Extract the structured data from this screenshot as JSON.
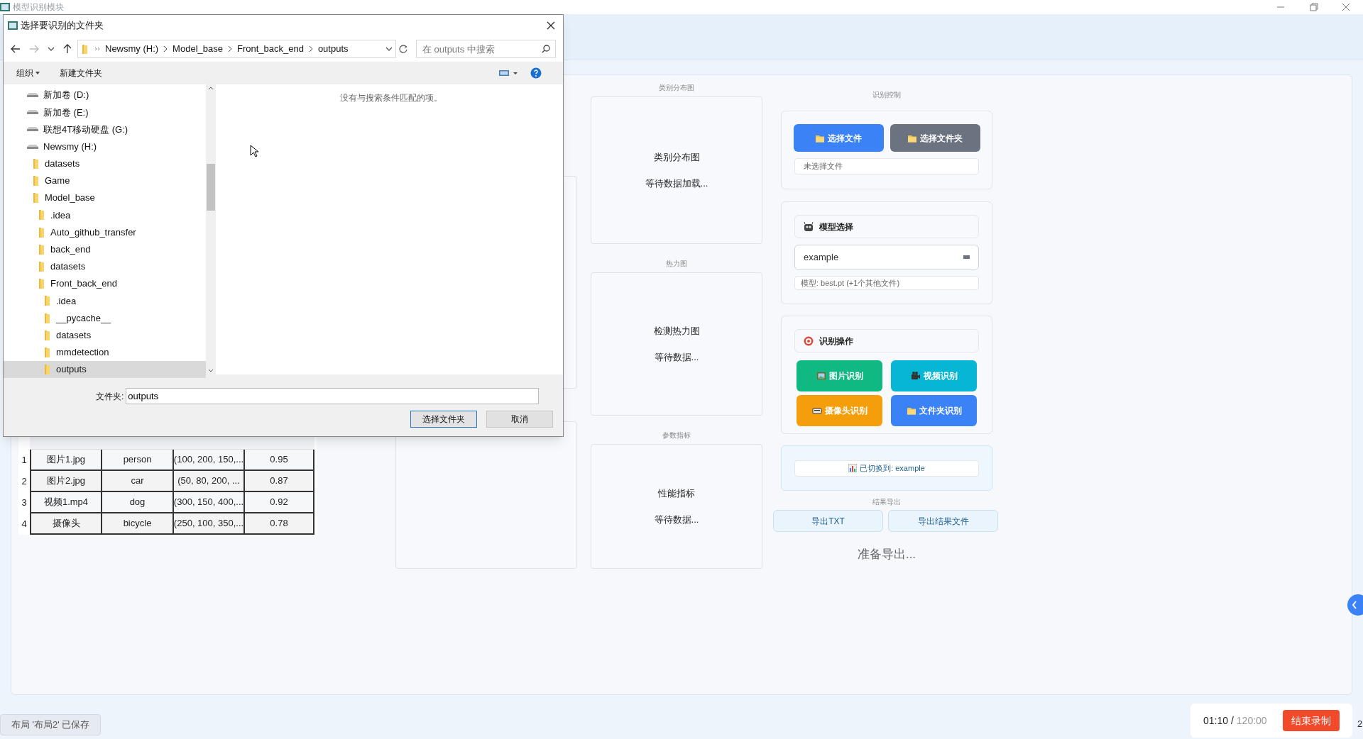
{
  "app_window": {
    "title": "模型识别模块"
  },
  "dialog": {
    "title": "选择要识别的文件夹",
    "breadcrumb": [
      "Newsmy (H:)",
      "Model_base",
      "Front_back_end",
      "outputs"
    ],
    "search": {
      "placeholder": "在 outputs 中搜索"
    },
    "toolbar": [
      "组织",
      "新建文件夹"
    ],
    "tree": [
      {
        "label": "新加卷 (D:)",
        "kind": "drive",
        "selected": false
      },
      {
        "label": "新加卷 (E:)",
        "kind": "drive",
        "selected": false
      },
      {
        "label": "联想4T移动硬盘 (G:)",
        "kind": "drive",
        "selected": false
      },
      {
        "label": "Newsmy (H:)",
        "kind": "drive",
        "selected": false,
        "children": [
          {
            "label": "datasets",
            "kind": "folder",
            "selected": false
          },
          {
            "label": "Game",
            "kind": "folder",
            "selected": false
          },
          {
            "label": "Model_base",
            "kind": "folder",
            "selected": false,
            "children": [
              {
                "label": ".idea",
                "kind": "folder",
                "selected": false
              },
              {
                "label": "Auto_github_transfer",
                "kind": "folder",
                "selected": false
              },
              {
                "label": "back_end",
                "kind": "folder",
                "selected": false
              },
              {
                "label": "datasets",
                "kind": "folder",
                "selected": false
              },
              {
                "label": "Front_back_end",
                "kind": "folder",
                "selected": false,
                "children": [
                  {
                    "label": ".idea",
                    "kind": "folder",
                    "selected": false
                  },
                  {
                    "label": "__pycache__",
                    "kind": "folder",
                    "selected": false
                  },
                  {
                    "label": "datasets",
                    "kind": "folder",
                    "selected": false
                  },
                  {
                    "label": "mmdetection",
                    "kind": "folder",
                    "selected": false
                  },
                  {
                    "label": "outputs",
                    "kind": "folder",
                    "selected": true
                  }
                ]
              }
            ]
          }
        ]
      }
    ],
    "empty_message": "没有与搜索条件匹配的项。",
    "folder_label": "文件夹:",
    "folder_value": "outputs",
    "buttons": [
      {
        "label": "选择文件夹",
        "kind": "default"
      },
      {
        "label": "取消",
        "kind": "normal"
      }
    ]
  },
  "results_table": {
    "rows": [
      {
        "index": "1",
        "cells": [
          "图片1.jpg",
          "person",
          "(100, 200, 150,...",
          "0.95"
        ]
      },
      {
        "index": "2",
        "cells": [
          "图片2.jpg",
          "car",
          "(50, 80, 200, ...",
          "0.87"
        ]
      },
      {
        "index": "3",
        "cells": [
          "视频1.mp4",
          "dog",
          "(300, 150, 400,...",
          "0.92"
        ]
      },
      {
        "index": "4",
        "cells": [
          "摄像头",
          "bicycle",
          "(250, 100, 350,...",
          "0.78"
        ]
      }
    ]
  },
  "charts": [
    {
      "section": "类别分布图",
      "title": "类别分布图",
      "status": "等待数据加载..."
    },
    {
      "section": "热力图",
      "title": "检测热力图",
      "status": "等待数据..."
    },
    {
      "section": "参数指标",
      "title": "性能指标",
      "status": "等待数据..."
    }
  ],
  "control": {
    "section": "识别控制",
    "file_buttons": [
      {
        "label": "选择文件",
        "kind": "primary"
      },
      {
        "label": "选择文件夹",
        "kind": "secondary"
      }
    ],
    "file_status": "未选择文件",
    "model_heading": "模型选择",
    "model_select": "example",
    "model_info": "模型: best.pt (+1个其他文件)",
    "ops_heading": "识别操作",
    "ops": [
      {
        "label": "图片识别",
        "kind": "image",
        "color": "#10b981"
      },
      {
        "label": "视频识别",
        "kind": "video",
        "color": "#06b6d4"
      },
      {
        "label": "摄像头识别",
        "kind": "camera",
        "color": "#f59e0b"
      },
      {
        "label": "文件夹识别",
        "kind": "folder",
        "color": "#3b82f6"
      }
    ],
    "switch_notice": "已切换到: example"
  },
  "export": {
    "section": "结果导出",
    "buttons": [
      "导出TXT",
      "导出结果文件"
    ],
    "status": "准备导出..."
  },
  "status_toast": "布局 '布局2' 已保存",
  "recording": {
    "elapsed": "01:10 /",
    "limit": "120:00",
    "button": "结束录制"
  },
  "edge_text": "2"
}
